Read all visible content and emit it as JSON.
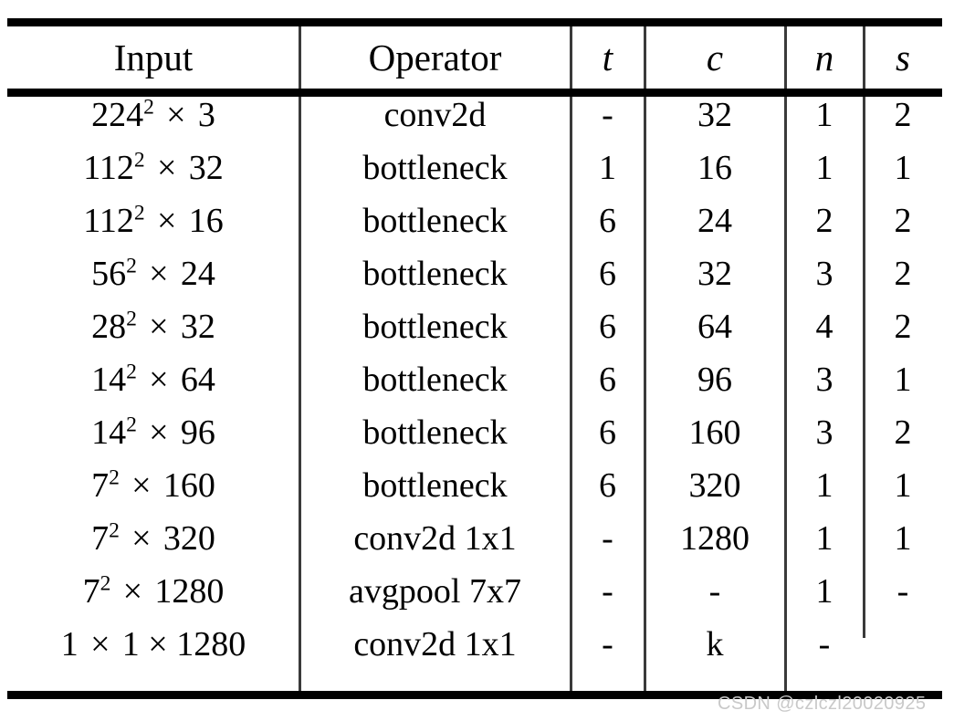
{
  "figure": {
    "kind": "architecture-table",
    "watermark": "CSDN @czlczl20020925"
  },
  "table": {
    "headers": {
      "input": "Input",
      "operator": "Operator",
      "t": "t",
      "c": "c",
      "n": "n",
      "s": "s"
    },
    "rows": [
      {
        "input_base": "224",
        "input_exp": "2",
        "input_tail": "3",
        "input_text": "224² × 3",
        "operator": "conv2d",
        "t": "-",
        "c": "32",
        "n": "1",
        "s": "2"
      },
      {
        "input_base": "112",
        "input_exp": "2",
        "input_tail": "32",
        "input_text": "112² × 32",
        "operator": "bottleneck",
        "t": "1",
        "c": "16",
        "n": "1",
        "s": "1"
      },
      {
        "input_base": "112",
        "input_exp": "2",
        "input_tail": "16",
        "input_text": "112² × 16",
        "operator": "bottleneck",
        "t": "6",
        "c": "24",
        "n": "2",
        "s": "2"
      },
      {
        "input_base": "56",
        "input_exp": "2",
        "input_tail": "24",
        "input_text": "56² × 24",
        "operator": "bottleneck",
        "t": "6",
        "c": "32",
        "n": "3",
        "s": "2"
      },
      {
        "input_base": "28",
        "input_exp": "2",
        "input_tail": "32",
        "input_text": "28² × 32",
        "operator": "bottleneck",
        "t": "6",
        "c": "64",
        "n": "4",
        "s": "2"
      },
      {
        "input_base": "14",
        "input_exp": "2",
        "input_tail": "64",
        "input_text": "14² × 64",
        "operator": "bottleneck",
        "t": "6",
        "c": "96",
        "n": "3",
        "s": "1"
      },
      {
        "input_base": "14",
        "input_exp": "2",
        "input_tail": "96",
        "input_text": "14² × 96",
        "operator": "bottleneck",
        "t": "6",
        "c": "160",
        "n": "3",
        "s": "2"
      },
      {
        "input_base": "7",
        "input_exp": "2",
        "input_tail": "160",
        "input_text": "7² × 160",
        "operator": "bottleneck",
        "t": "6",
        "c": "320",
        "n": "1",
        "s": "1"
      },
      {
        "input_base": "7",
        "input_exp": "2",
        "input_tail": "320",
        "input_text": "7² × 320",
        "operator": "conv2d 1x1",
        "t": "-",
        "c": "1280",
        "n": "1",
        "s": "1"
      },
      {
        "input_base": "7",
        "input_exp": "2",
        "input_tail": "1280",
        "input_text": "7² × 1280",
        "operator": "avgpool 7x7",
        "t": "-",
        "c": "-",
        "n": "1",
        "s": "-"
      },
      {
        "input_base": "1",
        "input_exp": "",
        "input_tail": "1 × 1280",
        "input_text": "1 × 1 × 1280",
        "operator": "conv2d 1x1",
        "t": "-",
        "c": "k",
        "n": "-",
        "s": ""
      }
    ]
  }
}
